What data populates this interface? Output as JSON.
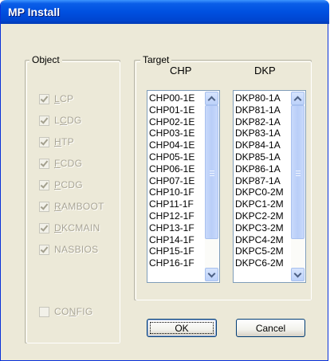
{
  "window": {
    "title": "MP Install"
  },
  "object_group": {
    "legend": "Object",
    "items": [
      {
        "pre": "",
        "accel": "L",
        "post": "CP",
        "checked": true
      },
      {
        "pre": "L",
        "accel": "C",
        "post": "DG",
        "checked": true
      },
      {
        "pre": "",
        "accel": "H",
        "post": "TP",
        "checked": true
      },
      {
        "pre": "",
        "accel": "F",
        "post": "CDG",
        "checked": true
      },
      {
        "pre": "",
        "accel": "P",
        "post": "CDG",
        "checked": true
      },
      {
        "pre": "",
        "accel": "R",
        "post": "AMBOOT",
        "checked": true
      },
      {
        "pre": "",
        "accel": "D",
        "post": "KCMAIN",
        "checked": true
      },
      {
        "pre": "",
        "accel": "",
        "post": "NASBIOS",
        "checked": true
      }
    ],
    "config": {
      "pre": "CO",
      "accel": "N",
      "post": "FIG",
      "checked": false
    }
  },
  "target_group": {
    "legend": "Target",
    "chp": {
      "header": "CHP",
      "items": [
        "CHP00-1E",
        "CHP01-1E",
        "CHP02-1E",
        "CHP03-1E",
        "CHP04-1E",
        "CHP05-1E",
        "CHP06-1E",
        "CHP07-1E",
        "CHP10-1F",
        "CHP11-1F",
        "CHP12-1F",
        "CHP13-1F",
        "CHP14-1F",
        "CHP15-1F",
        "CHP16-1F"
      ],
      "scroll": 0.0
    },
    "dkp": {
      "header": "DKP",
      "items": [
        "DKP80-1A",
        "DKP81-1A",
        "DKP82-1A",
        "DKP83-1A",
        "DKP84-1A",
        "DKP85-1A",
        "DKP86-1A",
        "DKP87-1A",
        "DKPC0-2M",
        "DKPC1-2M",
        "DKPC2-2M",
        "DKPC3-2M",
        "DKPC4-2M",
        "DKPC5-2M",
        "DKPC6-2M"
      ],
      "scroll": 0.0
    }
  },
  "buttons": {
    "ok": "OK",
    "cancel": "Cancel"
  }
}
